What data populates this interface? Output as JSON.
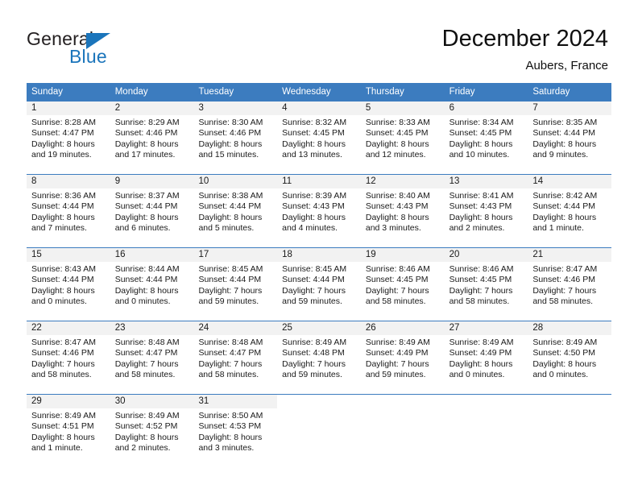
{
  "brand": {
    "name_part1": "General",
    "name_part2": "Blue",
    "color_blue": "#1b75bb",
    "color_dark": "#231f20"
  },
  "header": {
    "title": "December 2024",
    "subtitle": "Aubers, France"
  },
  "theme": {
    "header_blue": "#3c7cbf",
    "day_number_bg": "#f2f2f2",
    "text": "#1a1a1a"
  },
  "weekdays": [
    "Sunday",
    "Monday",
    "Tuesday",
    "Wednesday",
    "Thursday",
    "Friday",
    "Saturday"
  ],
  "weeks": [
    [
      {
        "day": "1",
        "sunrise": "Sunrise: 8:28 AM",
        "sunset": "Sunset: 4:47 PM",
        "daylight_1": "Daylight: 8 hours",
        "daylight_2": "and 19 minutes."
      },
      {
        "day": "2",
        "sunrise": "Sunrise: 8:29 AM",
        "sunset": "Sunset: 4:46 PM",
        "daylight_1": "Daylight: 8 hours",
        "daylight_2": "and 17 minutes."
      },
      {
        "day": "3",
        "sunrise": "Sunrise: 8:30 AM",
        "sunset": "Sunset: 4:46 PM",
        "daylight_1": "Daylight: 8 hours",
        "daylight_2": "and 15 minutes."
      },
      {
        "day": "4",
        "sunrise": "Sunrise: 8:32 AM",
        "sunset": "Sunset: 4:45 PM",
        "daylight_1": "Daylight: 8 hours",
        "daylight_2": "and 13 minutes."
      },
      {
        "day": "5",
        "sunrise": "Sunrise: 8:33 AM",
        "sunset": "Sunset: 4:45 PM",
        "daylight_1": "Daylight: 8 hours",
        "daylight_2": "and 12 minutes."
      },
      {
        "day": "6",
        "sunrise": "Sunrise: 8:34 AM",
        "sunset": "Sunset: 4:45 PM",
        "daylight_1": "Daylight: 8 hours",
        "daylight_2": "and 10 minutes."
      },
      {
        "day": "7",
        "sunrise": "Sunrise: 8:35 AM",
        "sunset": "Sunset: 4:44 PM",
        "daylight_1": "Daylight: 8 hours",
        "daylight_2": "and 9 minutes."
      }
    ],
    [
      {
        "day": "8",
        "sunrise": "Sunrise: 8:36 AM",
        "sunset": "Sunset: 4:44 PM",
        "daylight_1": "Daylight: 8 hours",
        "daylight_2": "and 7 minutes."
      },
      {
        "day": "9",
        "sunrise": "Sunrise: 8:37 AM",
        "sunset": "Sunset: 4:44 PM",
        "daylight_1": "Daylight: 8 hours",
        "daylight_2": "and 6 minutes."
      },
      {
        "day": "10",
        "sunrise": "Sunrise: 8:38 AM",
        "sunset": "Sunset: 4:44 PM",
        "daylight_1": "Daylight: 8 hours",
        "daylight_2": "and 5 minutes."
      },
      {
        "day": "11",
        "sunrise": "Sunrise: 8:39 AM",
        "sunset": "Sunset: 4:43 PM",
        "daylight_1": "Daylight: 8 hours",
        "daylight_2": "and 4 minutes."
      },
      {
        "day": "12",
        "sunrise": "Sunrise: 8:40 AM",
        "sunset": "Sunset: 4:43 PM",
        "daylight_1": "Daylight: 8 hours",
        "daylight_2": "and 3 minutes."
      },
      {
        "day": "13",
        "sunrise": "Sunrise: 8:41 AM",
        "sunset": "Sunset: 4:43 PM",
        "daylight_1": "Daylight: 8 hours",
        "daylight_2": "and 2 minutes."
      },
      {
        "day": "14",
        "sunrise": "Sunrise: 8:42 AM",
        "sunset": "Sunset: 4:44 PM",
        "daylight_1": "Daylight: 8 hours",
        "daylight_2": "and 1 minute."
      }
    ],
    [
      {
        "day": "15",
        "sunrise": "Sunrise: 8:43 AM",
        "sunset": "Sunset: 4:44 PM",
        "daylight_1": "Daylight: 8 hours",
        "daylight_2": "and 0 minutes."
      },
      {
        "day": "16",
        "sunrise": "Sunrise: 8:44 AM",
        "sunset": "Sunset: 4:44 PM",
        "daylight_1": "Daylight: 8 hours",
        "daylight_2": "and 0 minutes."
      },
      {
        "day": "17",
        "sunrise": "Sunrise: 8:45 AM",
        "sunset": "Sunset: 4:44 PM",
        "daylight_1": "Daylight: 7 hours",
        "daylight_2": "and 59 minutes."
      },
      {
        "day": "18",
        "sunrise": "Sunrise: 8:45 AM",
        "sunset": "Sunset: 4:44 PM",
        "daylight_1": "Daylight: 7 hours",
        "daylight_2": "and 59 minutes."
      },
      {
        "day": "19",
        "sunrise": "Sunrise: 8:46 AM",
        "sunset": "Sunset: 4:45 PM",
        "daylight_1": "Daylight: 7 hours",
        "daylight_2": "and 58 minutes."
      },
      {
        "day": "20",
        "sunrise": "Sunrise: 8:46 AM",
        "sunset": "Sunset: 4:45 PM",
        "daylight_1": "Daylight: 7 hours",
        "daylight_2": "and 58 minutes."
      },
      {
        "day": "21",
        "sunrise": "Sunrise: 8:47 AM",
        "sunset": "Sunset: 4:46 PM",
        "daylight_1": "Daylight: 7 hours",
        "daylight_2": "and 58 minutes."
      }
    ],
    [
      {
        "day": "22",
        "sunrise": "Sunrise: 8:47 AM",
        "sunset": "Sunset: 4:46 PM",
        "daylight_1": "Daylight: 7 hours",
        "daylight_2": "and 58 minutes."
      },
      {
        "day": "23",
        "sunrise": "Sunrise: 8:48 AM",
        "sunset": "Sunset: 4:47 PM",
        "daylight_1": "Daylight: 7 hours",
        "daylight_2": "and 58 minutes."
      },
      {
        "day": "24",
        "sunrise": "Sunrise: 8:48 AM",
        "sunset": "Sunset: 4:47 PM",
        "daylight_1": "Daylight: 7 hours",
        "daylight_2": "and 58 minutes."
      },
      {
        "day": "25",
        "sunrise": "Sunrise: 8:49 AM",
        "sunset": "Sunset: 4:48 PM",
        "daylight_1": "Daylight: 7 hours",
        "daylight_2": "and 59 minutes."
      },
      {
        "day": "26",
        "sunrise": "Sunrise: 8:49 AM",
        "sunset": "Sunset: 4:49 PM",
        "daylight_1": "Daylight: 7 hours",
        "daylight_2": "and 59 minutes."
      },
      {
        "day": "27",
        "sunrise": "Sunrise: 8:49 AM",
        "sunset": "Sunset: 4:49 PM",
        "daylight_1": "Daylight: 8 hours",
        "daylight_2": "and 0 minutes."
      },
      {
        "day": "28",
        "sunrise": "Sunrise: 8:49 AM",
        "sunset": "Sunset: 4:50 PM",
        "daylight_1": "Daylight: 8 hours",
        "daylight_2": "and 0 minutes."
      }
    ],
    [
      {
        "day": "29",
        "sunrise": "Sunrise: 8:49 AM",
        "sunset": "Sunset: 4:51 PM",
        "daylight_1": "Daylight: 8 hours",
        "daylight_2": "and 1 minute."
      },
      {
        "day": "30",
        "sunrise": "Sunrise: 8:49 AM",
        "sunset": "Sunset: 4:52 PM",
        "daylight_1": "Daylight: 8 hours",
        "daylight_2": "and 2 minutes."
      },
      {
        "day": "31",
        "sunrise": "Sunrise: 8:50 AM",
        "sunset": "Sunset: 4:53 PM",
        "daylight_1": "Daylight: 8 hours",
        "daylight_2": "and 3 minutes."
      },
      {
        "day": "",
        "sunrise": "",
        "sunset": "",
        "daylight_1": "",
        "daylight_2": ""
      },
      {
        "day": "",
        "sunrise": "",
        "sunset": "",
        "daylight_1": "",
        "daylight_2": ""
      },
      {
        "day": "",
        "sunrise": "",
        "sunset": "",
        "daylight_1": "",
        "daylight_2": ""
      },
      {
        "day": "",
        "sunrise": "",
        "sunset": "",
        "daylight_1": "",
        "daylight_2": ""
      }
    ]
  ]
}
